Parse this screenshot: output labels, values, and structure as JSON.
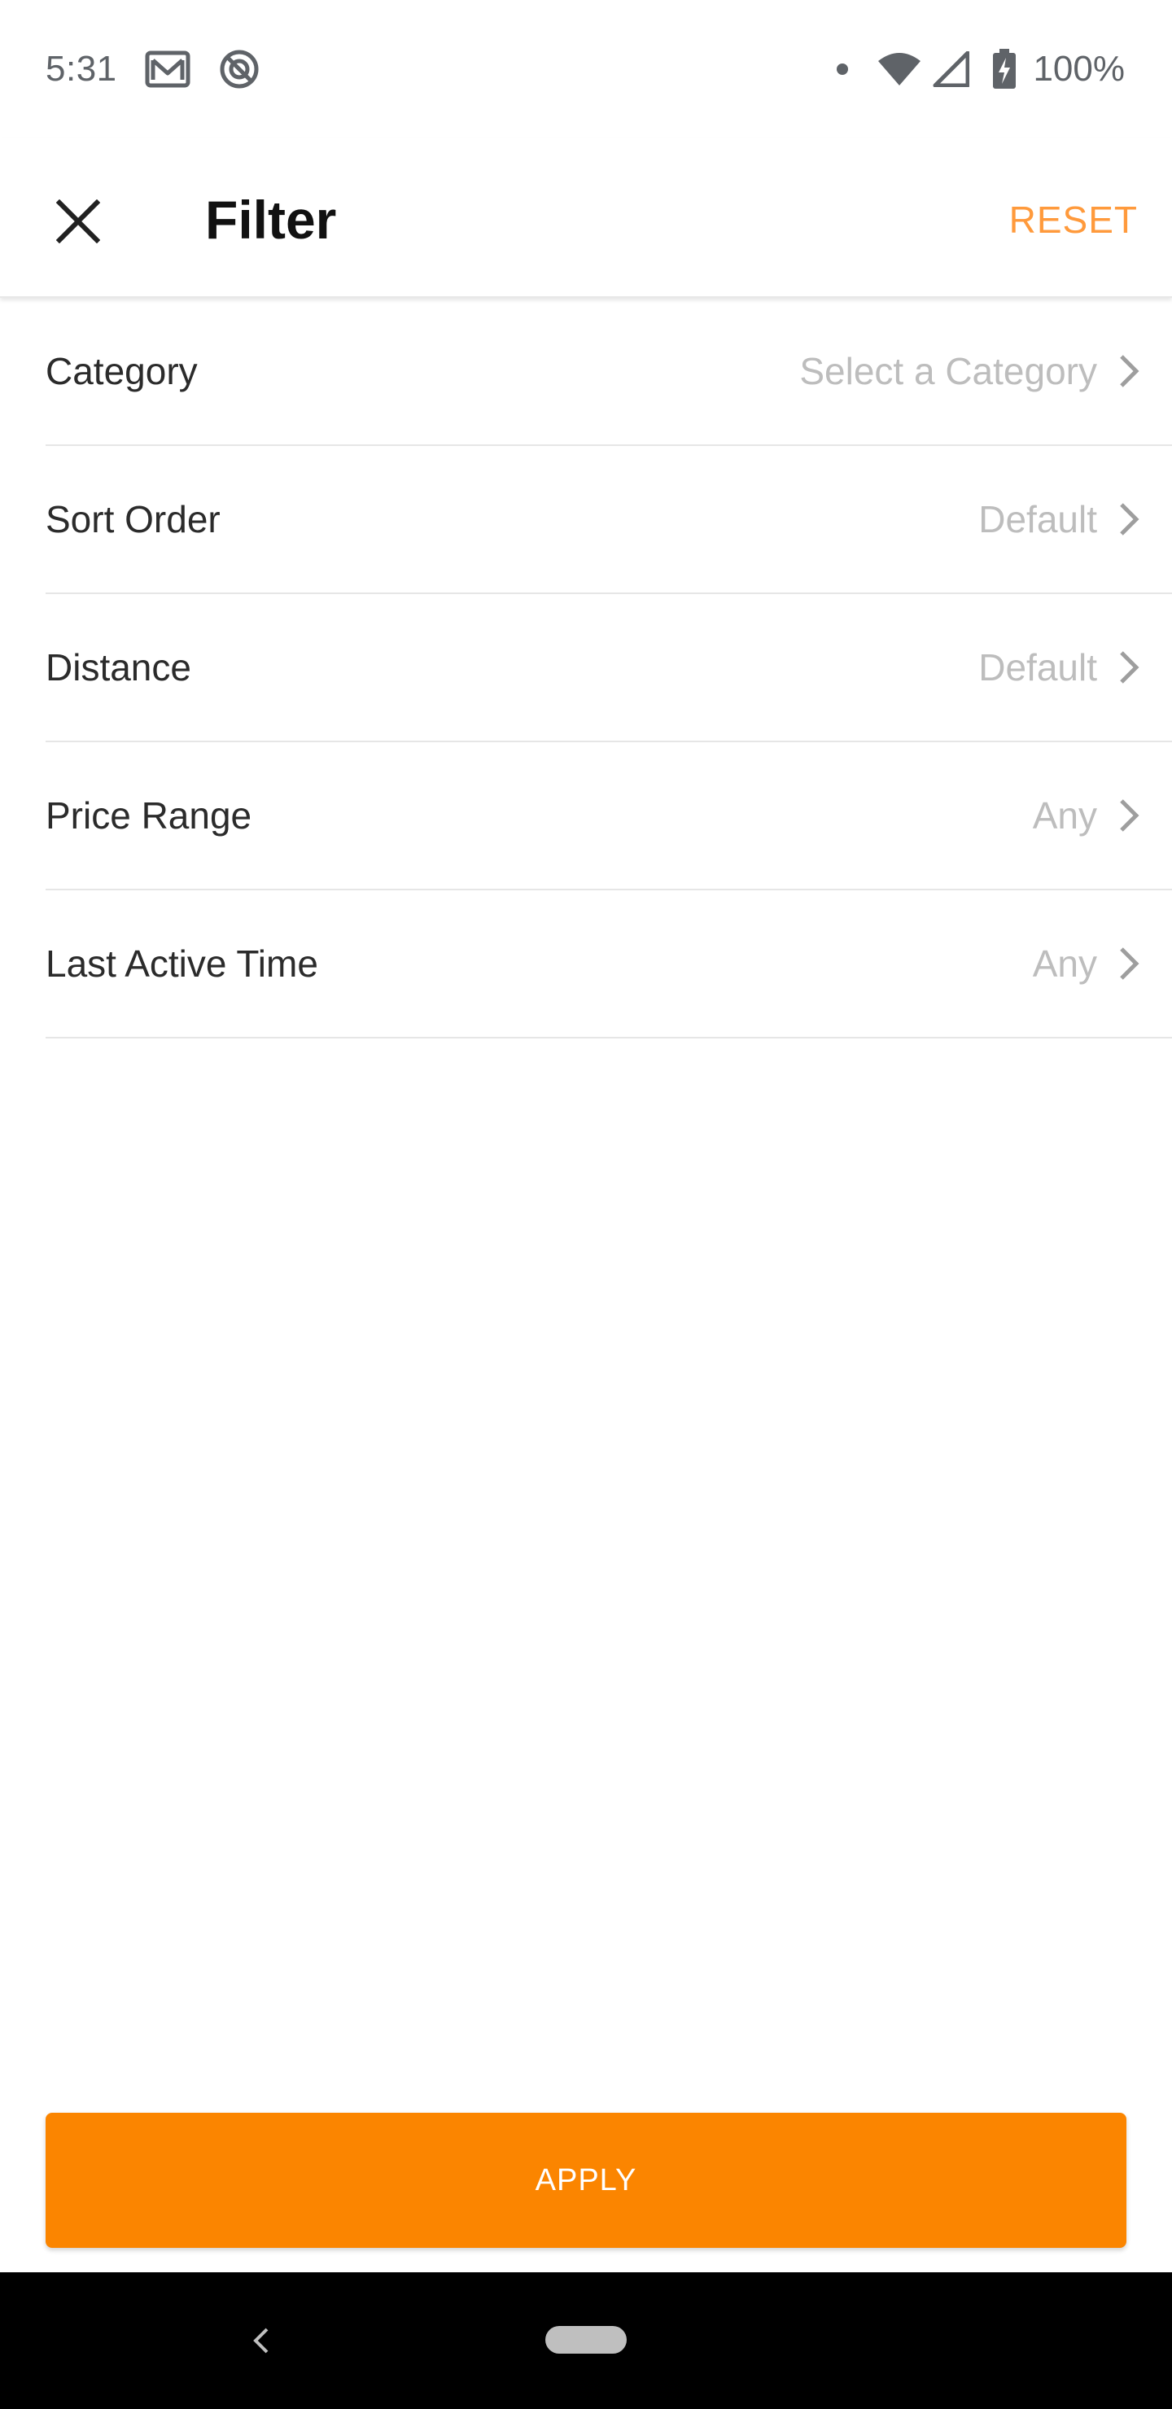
{
  "status_bar": {
    "time": "5:31",
    "battery_percent": "100%",
    "icons": [
      "gmail-icon",
      "do-not-disturb-icon",
      "notification-dot-icon",
      "wifi-icon",
      "cellular-signal-icon",
      "battery-charging-icon"
    ]
  },
  "app_bar": {
    "title": "Filter",
    "reset_label": "RESET",
    "close_icon": "close-icon"
  },
  "filters": [
    {
      "label": "Category",
      "value": "Select a Category"
    },
    {
      "label": "Sort Order",
      "value": "Default"
    },
    {
      "label": "Distance",
      "value": "Default"
    },
    {
      "label": "Price Range",
      "value": "Any"
    },
    {
      "label": "Last Active Time",
      "value": "Any"
    }
  ],
  "apply_label": "APPLY",
  "nav_bar": {
    "back_icon": "back-icon",
    "home_icon": "home-pill-icon"
  },
  "colors": {
    "accent": "#fb8500",
    "reset_text": "#ff9a3c",
    "muted_value": "#bdbdbd",
    "chevron": "#9e9e9e"
  }
}
